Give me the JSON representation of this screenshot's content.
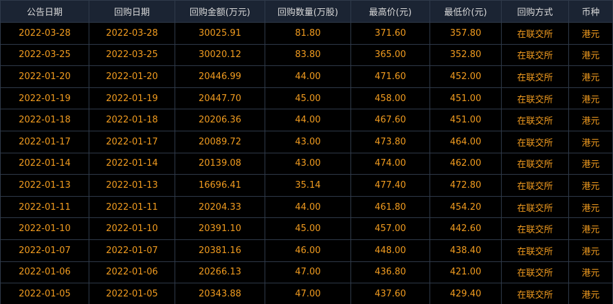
{
  "table": {
    "headers": [
      "公告日期",
      "回购日期",
      "回购金额(万元)",
      "回购数量(万股)",
      "最高价(元)",
      "最低价(元)",
      "回购方式",
      "币种"
    ],
    "rows": [
      [
        "2022-03-28",
        "2022-03-28",
        "30025.91",
        "81.80",
        "371.60",
        "357.80",
        "在联交所",
        "港元"
      ],
      [
        "2022-03-25",
        "2022-03-25",
        "30020.12",
        "83.80",
        "365.00",
        "352.80",
        "在联交所",
        "港元"
      ],
      [
        "2022-01-20",
        "2022-01-20",
        "20446.99",
        "44.00",
        "471.60",
        "452.00",
        "在联交所",
        "港元"
      ],
      [
        "2022-01-19",
        "2022-01-19",
        "20447.70",
        "45.00",
        "458.00",
        "451.00",
        "在联交所",
        "港元"
      ],
      [
        "2022-01-18",
        "2022-01-18",
        "20206.36",
        "44.00",
        "467.60",
        "451.00",
        "在联交所",
        "港元"
      ],
      [
        "2022-01-17",
        "2022-01-17",
        "20089.72",
        "43.00",
        "473.80",
        "464.00",
        "在联交所",
        "港元"
      ],
      [
        "2022-01-14",
        "2022-01-14",
        "20139.08",
        "43.00",
        "474.00",
        "462.00",
        "在联交所",
        "港元"
      ],
      [
        "2022-01-13",
        "2022-01-13",
        "16696.41",
        "35.14",
        "477.40",
        "472.80",
        "在联交所",
        "港元"
      ],
      [
        "2022-01-11",
        "2022-01-11",
        "20204.33",
        "44.00",
        "461.80",
        "454.20",
        "在联交所",
        "港元"
      ],
      [
        "2022-01-10",
        "2022-01-10",
        "20391.10",
        "45.00",
        "457.00",
        "442.60",
        "在联交所",
        "港元"
      ],
      [
        "2022-01-07",
        "2022-01-07",
        "20381.16",
        "46.00",
        "448.00",
        "438.40",
        "在联交所",
        "港元"
      ],
      [
        "2022-01-06",
        "2022-01-06",
        "20266.13",
        "47.00",
        "436.80",
        "421.00",
        "在联交所",
        "港元"
      ],
      [
        "2022-01-05",
        "2022-01-05",
        "20343.88",
        "47.00",
        "437.60",
        "429.40",
        "在联交所",
        "港元"
      ]
    ],
    "colors": {
      "header_bg": "#1b2433",
      "header_text": "#d9d9d9",
      "cell_text": "#f29c1f",
      "border": "#2f3a4a",
      "background": "#000000"
    }
  }
}
